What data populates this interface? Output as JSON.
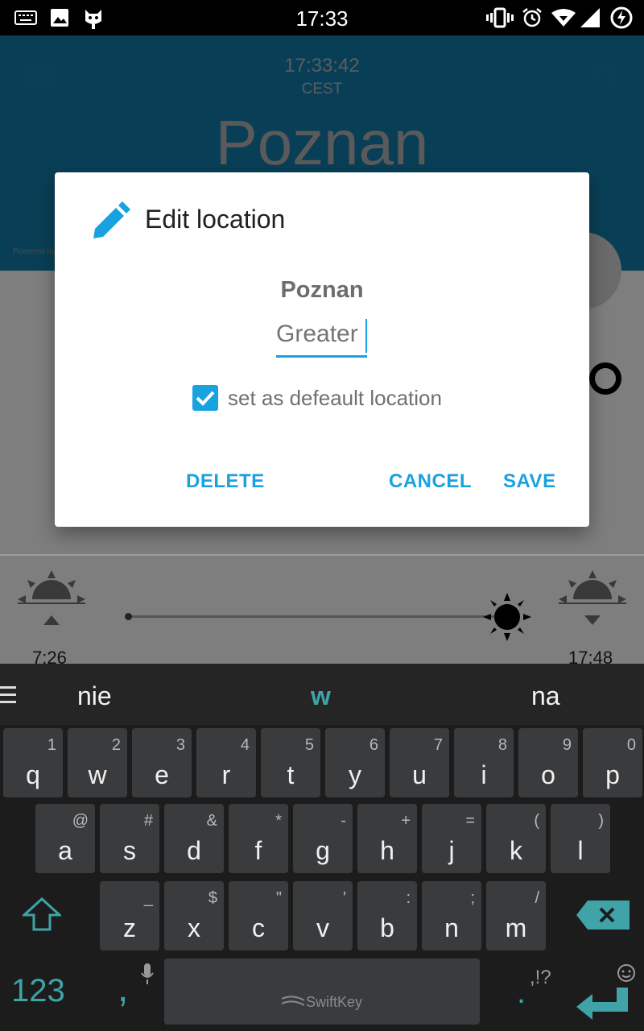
{
  "status_bar": {
    "time": "17:33"
  },
  "app": {
    "clock": "17:33:42",
    "timezone": "CEST",
    "city": "Poznan",
    "powered_by": "Powered by",
    "sunrise": "7:26",
    "sunset": "17:48"
  },
  "dialog": {
    "title": "Edit location",
    "location_name": "Poznan",
    "input_value": "Greater",
    "checkbox_label": "set as defeault location",
    "checkbox_checked": true,
    "buttons": {
      "delete": "DELETE",
      "cancel": "CANCEL",
      "save": "SAVE"
    }
  },
  "keyboard": {
    "suggestions": [
      "nie",
      "w",
      "na"
    ],
    "row1": [
      {
        "k": "q",
        "a": "1"
      },
      {
        "k": "w",
        "a": "2"
      },
      {
        "k": "e",
        "a": "3"
      },
      {
        "k": "r",
        "a": "4"
      },
      {
        "k": "t",
        "a": "5"
      },
      {
        "k": "y",
        "a": "6"
      },
      {
        "k": "u",
        "a": "7"
      },
      {
        "k": "i",
        "a": "8"
      },
      {
        "k": "o",
        "a": "9"
      },
      {
        "k": "p",
        "a": "0"
      }
    ],
    "row2": [
      {
        "k": "a",
        "a": "@"
      },
      {
        "k": "s",
        "a": "#"
      },
      {
        "k": "d",
        "a": "&"
      },
      {
        "k": "f",
        "a": "*"
      },
      {
        "k": "g",
        "a": "-"
      },
      {
        "k": "h",
        "a": "+"
      },
      {
        "k": "j",
        "a": "="
      },
      {
        "k": "k",
        "a": "("
      },
      {
        "k": "l",
        "a": ")"
      }
    ],
    "row3": [
      {
        "k": "z",
        "a": "_"
      },
      {
        "k": "x",
        "a": "$"
      },
      {
        "k": "c",
        "a": "\""
      },
      {
        "k": "v",
        "a": "'"
      },
      {
        "k": "b",
        "a": ":"
      },
      {
        "k": "n",
        "a": ";"
      },
      {
        "k": "m",
        "a": "/"
      }
    ],
    "numbers_label": "123",
    "comma": ",",
    "period": ".",
    "punct_label": ",!?",
    "space_brand": "SwiftKey"
  },
  "colors": {
    "accent": "#19a2e0",
    "appbar": "#1379a6",
    "keyboard_bg": "#1c1c1c"
  },
  "icons": [
    "keyboard-icon",
    "image-icon",
    "cyanogen-icon",
    "vibrate-icon",
    "alarm-icon",
    "wifi-icon",
    "signal-icon",
    "battery-charging-icon",
    "menu-icon",
    "search-icon",
    "pencil-icon",
    "sunrise-icon",
    "sun-icon",
    "sunset-icon",
    "shift-icon",
    "backspace-icon",
    "mic-icon",
    "emoji-icon",
    "enter-icon"
  ]
}
